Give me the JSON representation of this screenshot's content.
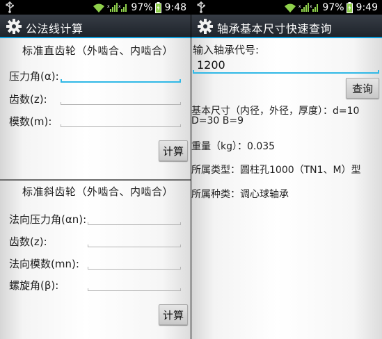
{
  "left": {
    "status": {
      "battery_text": "97%",
      "time": "9:48"
    },
    "title": "公法线计算",
    "spur": {
      "heading": "标准直齿轮（外啮合、内啮合）",
      "pressure_angle_label": "压力角(α):",
      "teeth_label": "齿数(z):",
      "module_label": "模数(m):",
      "calc_button": "计算"
    },
    "helical": {
      "heading": "标准斜齿轮（外啮合、内啮合）",
      "normal_pressure_angle_label": "法向压力角(αn):",
      "teeth_label": "齿数(z):",
      "normal_module_label": "法向模数(mn):",
      "helix_angle_label": "螺旋角(β):",
      "calc_button": "计算"
    }
  },
  "right": {
    "status": {
      "battery_text": "97%",
      "time": "9:49"
    },
    "title": "轴承基本尺寸快速查询",
    "input_label": "输入轴承代号:",
    "input_value": "1200",
    "query_button": "查询",
    "dims_line1": "基本尺寸（内径，外径，厚度）：d=10",
    "dims_line2": "D=30  B=9",
    "weight": "重量（kg）：0.035",
    "type": "所属类型：圆柱孔1000（TN1、M）型",
    "kind": "所属种类：调心球轴承"
  },
  "colors": {
    "accent": "#2fb8e6",
    "actionbar": "#2a3038",
    "statusbar": "#000000",
    "battery": "#8fd04b"
  },
  "icons": [
    "usb-icon",
    "wifi-icon",
    "signal-icon",
    "battery-icon",
    "gear-icon"
  ]
}
